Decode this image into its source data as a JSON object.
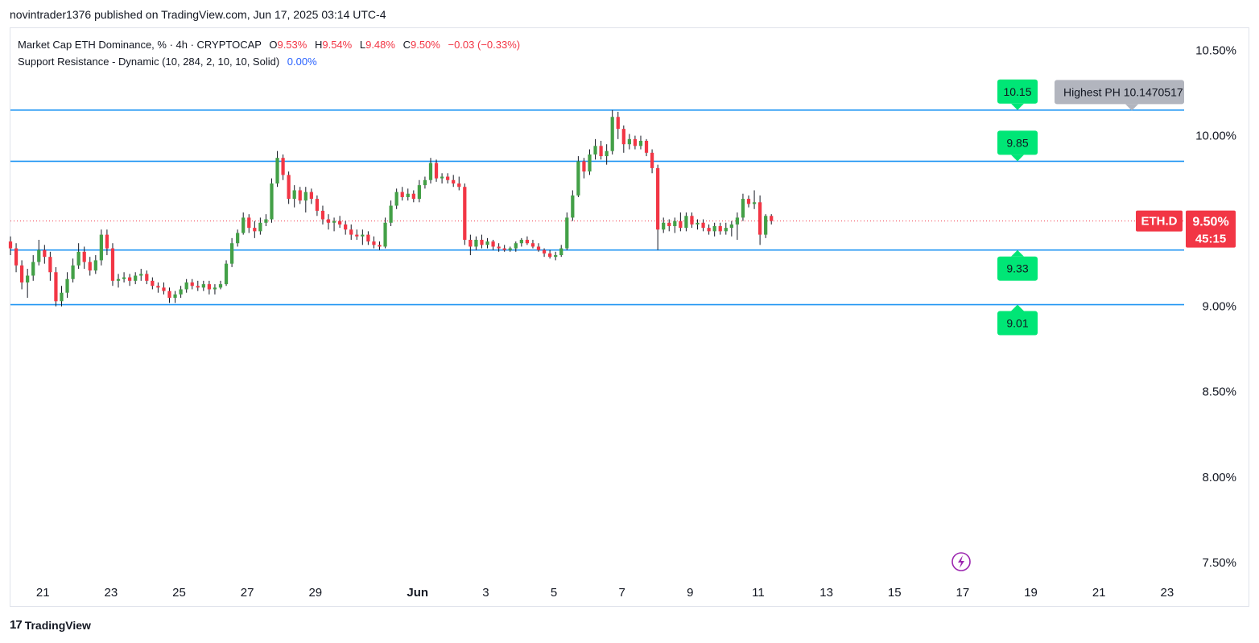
{
  "header": {
    "caption": "novintrader1376 published on TradingView.com, Jun 17, 2025 03:14 UTC-4"
  },
  "legend": {
    "symbol_line": "Market Cap ETH Dominance, % · 4h · CRYPTOCAP",
    "o_key": "O",
    "o_val": "9.53%",
    "h_key": "H",
    "h_val": "9.54%",
    "l_key": "L",
    "l_val": "9.48%",
    "c_key": "C",
    "c_val": "9.50%",
    "change": "−0.03 (−0.33%)",
    "indicator_line": "Support Resistance - Dynamic (10, 284, 2, 10, 10, Solid)",
    "indicator_val": "0.00%"
  },
  "footer": {
    "brand_mark": "17",
    "brand": "TradingView"
  },
  "colors": {
    "up": "#43a047",
    "down": "#f23645",
    "level": "#2196f3",
    "label_green": "#00e676",
    "label_gray": "#b2b5be",
    "price_badge": "#f23645",
    "wick": "#131722"
  },
  "chart_data": {
    "type": "candlestick",
    "y_unit": "%",
    "ylim": [
      7.4,
      10.63
    ],
    "y_ticks": [
      {
        "value": 10.5,
        "label": "10.50%"
      },
      {
        "value": 10.0,
        "label": "10.00%"
      },
      {
        "value": 9.0,
        "label": "9.00%"
      },
      {
        "value": 8.5,
        "label": "8.50%"
      },
      {
        "value": 8.0,
        "label": "8.00%"
      },
      {
        "value": 7.5,
        "label": "7.50%"
      }
    ],
    "x_ticks": [
      {
        "day": 21,
        "label": "21"
      },
      {
        "day": 23,
        "label": "23"
      },
      {
        "day": 25,
        "label": "25"
      },
      {
        "day": 27,
        "label": "27"
      },
      {
        "day": 29,
        "label": "29"
      },
      {
        "day": 32,
        "label": "Jun"
      },
      {
        "day": 34,
        "label": "3"
      },
      {
        "day": 36,
        "label": "5"
      },
      {
        "day": 38,
        "label": "7"
      },
      {
        "day": 40,
        "label": "9"
      },
      {
        "day": 42,
        "label": "11"
      },
      {
        "day": 44,
        "label": "13"
      },
      {
        "day": 46,
        "label": "15"
      },
      {
        "day": 48,
        "label": "17"
      },
      {
        "day": 50,
        "label": "19"
      },
      {
        "day": 52,
        "label": "21"
      },
      {
        "day": 54,
        "label": "23"
      }
    ],
    "x_range_days": [
      20.05,
      54.5
    ],
    "candle_start_day": 20.05,
    "candle_interval_days": 0.16667,
    "levels": [
      {
        "value": 10.15,
        "label": "10.15",
        "side": "resistance"
      },
      {
        "value": 9.85,
        "label": "9.85",
        "side": "resistance"
      },
      {
        "value": 9.33,
        "label": "9.33",
        "side": "support"
      },
      {
        "value": 9.01,
        "label": "9.01",
        "side": "support"
      }
    ],
    "highest_ph": {
      "label": "Highest PH 10.1470517",
      "value": 10.147
    },
    "last_price": {
      "symbol": "ETH.D",
      "value": "9.50%",
      "countdown": "45:15",
      "y": 9.5
    },
    "candles": [
      [
        9.38,
        9.41,
        9.3,
        9.34
      ],
      [
        9.34,
        9.37,
        9.2,
        9.24
      ],
      [
        9.24,
        9.27,
        9.1,
        9.14
      ],
      [
        9.14,
        9.22,
        9.05,
        9.18
      ],
      [
        9.18,
        9.3,
        9.15,
        9.26
      ],
      [
        9.26,
        9.39,
        9.24,
        9.33
      ],
      [
        9.33,
        9.36,
        9.25,
        9.29
      ],
      [
        9.29,
        9.32,
        9.15,
        9.2
      ],
      [
        9.2,
        9.23,
        9.0,
        9.03
      ],
      [
        9.03,
        9.12,
        9.0,
        9.08
      ],
      [
        9.08,
        9.2,
        9.05,
        9.16
      ],
      [
        9.16,
        9.28,
        9.14,
        9.24
      ],
      [
        9.24,
        9.37,
        9.22,
        9.32
      ],
      [
        9.32,
        9.35,
        9.22,
        9.26
      ],
      [
        9.26,
        9.29,
        9.18,
        9.21
      ],
      [
        9.21,
        9.3,
        9.19,
        9.27
      ],
      [
        9.27,
        9.45,
        9.24,
        9.42
      ],
      [
        9.42,
        9.45,
        9.3,
        9.34
      ],
      [
        9.34,
        9.37,
        9.12,
        9.15
      ],
      [
        9.15,
        9.19,
        9.11,
        9.16
      ],
      [
        9.16,
        9.2,
        9.14,
        9.17
      ],
      [
        9.17,
        9.19,
        9.12,
        9.15
      ],
      [
        9.15,
        9.2,
        9.13,
        9.18
      ],
      [
        9.18,
        9.22,
        9.15,
        9.19
      ],
      [
        9.19,
        9.21,
        9.13,
        9.15
      ],
      [
        9.15,
        9.17,
        9.1,
        9.12
      ],
      [
        9.12,
        9.14,
        9.08,
        9.11
      ],
      [
        9.11,
        9.14,
        9.07,
        9.09
      ],
      [
        9.09,
        9.11,
        9.02,
        9.05
      ],
      [
        9.05,
        9.09,
        9.02,
        9.07
      ],
      [
        9.07,
        9.12,
        9.05,
        9.1
      ],
      [
        9.1,
        9.16,
        9.08,
        9.14
      ],
      [
        9.14,
        9.16,
        9.1,
        9.12
      ],
      [
        9.12,
        9.15,
        9.09,
        9.11
      ],
      [
        9.11,
        9.15,
        9.09,
        9.13
      ],
      [
        9.13,
        9.15,
        9.07,
        9.1
      ],
      [
        9.1,
        9.13,
        9.07,
        9.11
      ],
      [
        9.11,
        9.15,
        9.1,
        9.13
      ],
      [
        9.13,
        9.27,
        9.12,
        9.25
      ],
      [
        9.25,
        9.4,
        9.23,
        9.37
      ],
      [
        9.37,
        9.45,
        9.35,
        9.43
      ],
      [
        9.43,
        9.55,
        9.42,
        9.52
      ],
      [
        9.52,
        9.54,
        9.43,
        9.46
      ],
      [
        9.46,
        9.5,
        9.4,
        9.44
      ],
      [
        9.44,
        9.52,
        9.42,
        9.49
      ],
      [
        9.49,
        9.54,
        9.47,
        9.51
      ],
      [
        9.51,
        9.75,
        9.49,
        9.72
      ],
      [
        9.72,
        9.91,
        9.7,
        9.87
      ],
      [
        9.87,
        9.89,
        9.74,
        9.77
      ],
      [
        9.77,
        9.79,
        9.6,
        9.63
      ],
      [
        9.63,
        9.71,
        9.58,
        9.68
      ],
      [
        9.68,
        9.7,
        9.6,
        9.62
      ],
      [
        9.62,
        9.7,
        9.55,
        9.67
      ],
      [
        9.67,
        9.69,
        9.6,
        9.63
      ],
      [
        9.63,
        9.65,
        9.53,
        9.56
      ],
      [
        9.56,
        9.59,
        9.48,
        9.51
      ],
      [
        9.51,
        9.54,
        9.45,
        9.49
      ],
      [
        9.49,
        9.52,
        9.44,
        9.5
      ],
      [
        9.5,
        9.53,
        9.46,
        9.48
      ],
      [
        9.48,
        9.5,
        9.42,
        9.45
      ],
      [
        9.45,
        9.48,
        9.39,
        9.42
      ],
      [
        9.42,
        9.45,
        9.39,
        9.41
      ],
      [
        9.41,
        9.45,
        9.36,
        9.42
      ],
      [
        9.42,
        9.44,
        9.36,
        9.38
      ],
      [
        9.38,
        9.41,
        9.34,
        9.36
      ],
      [
        9.36,
        9.38,
        9.33,
        9.35
      ],
      [
        9.35,
        9.52,
        9.34,
        9.49
      ],
      [
        9.49,
        9.62,
        9.47,
        9.59
      ],
      [
        9.59,
        9.69,
        9.57,
        9.67
      ],
      [
        9.67,
        9.7,
        9.62,
        9.64
      ],
      [
        9.64,
        9.69,
        9.62,
        9.66
      ],
      [
        9.66,
        9.68,
        9.61,
        9.63
      ],
      [
        9.63,
        9.74,
        9.61,
        9.71
      ],
      [
        9.71,
        9.76,
        9.69,
        9.74
      ],
      [
        9.74,
        9.87,
        9.72,
        9.84
      ],
      [
        9.84,
        9.86,
        9.73,
        9.75
      ],
      [
        9.75,
        9.78,
        9.72,
        9.76
      ],
      [
        9.76,
        9.78,
        9.72,
        9.74
      ],
      [
        9.74,
        9.77,
        9.7,
        9.72
      ],
      [
        9.72,
        9.76,
        9.68,
        9.7
      ],
      [
        9.7,
        9.72,
        9.36,
        9.39
      ],
      [
        9.39,
        9.42,
        9.3,
        9.35
      ],
      [
        9.35,
        9.41,
        9.33,
        9.39
      ],
      [
        9.39,
        9.42,
        9.34,
        9.36
      ],
      [
        9.36,
        9.4,
        9.34,
        9.38
      ],
      [
        9.38,
        9.39,
        9.33,
        9.35
      ],
      [
        9.35,
        9.37,
        9.32,
        9.34
      ],
      [
        9.34,
        9.36,
        9.32,
        9.33
      ],
      [
        9.33,
        9.35,
        9.32,
        9.34
      ],
      [
        9.34,
        9.38,
        9.32,
        9.37
      ],
      [
        9.37,
        9.4,
        9.35,
        9.39
      ],
      [
        9.39,
        9.41,
        9.36,
        9.37
      ],
      [
        9.37,
        9.39,
        9.34,
        9.35
      ],
      [
        9.35,
        9.37,
        9.32,
        9.33
      ],
      [
        9.33,
        9.34,
        9.29,
        9.31
      ],
      [
        9.31,
        9.33,
        9.28,
        9.29
      ],
      [
        9.29,
        9.32,
        9.27,
        9.3
      ],
      [
        9.3,
        9.36,
        9.29,
        9.34
      ],
      [
        9.34,
        9.55,
        9.33,
        9.52
      ],
      [
        9.52,
        9.68,
        9.5,
        9.65
      ],
      [
        9.65,
        9.88,
        9.64,
        9.85
      ],
      [
        9.85,
        9.87,
        9.75,
        9.79
      ],
      [
        9.79,
        9.92,
        9.77,
        9.89
      ],
      [
        9.89,
        9.98,
        9.86,
        9.94
      ],
      [
        9.94,
        9.97,
        9.86,
        9.88
      ],
      [
        9.88,
        9.95,
        9.83,
        9.91
      ],
      [
        9.91,
        10.15,
        9.89,
        10.11
      ],
      [
        10.11,
        10.14,
        9.98,
        10.04
      ],
      [
        10.04,
        10.06,
        9.9,
        9.95
      ],
      [
        9.95,
        10.01,
        9.92,
        9.98
      ],
      [
        9.98,
        10.0,
        9.92,
        9.94
      ],
      [
        9.94,
        10.0,
        9.92,
        9.97
      ],
      [
        9.97,
        9.98,
        9.88,
        9.9
      ],
      [
        9.9,
        9.92,
        9.78,
        9.81
      ],
      [
        9.81,
        9.83,
        9.33,
        9.45
      ],
      [
        9.45,
        9.52,
        9.43,
        9.49
      ],
      [
        9.49,
        9.51,
        9.44,
        9.47
      ],
      [
        9.47,
        9.52,
        9.43,
        9.5
      ],
      [
        9.5,
        9.55,
        9.44,
        9.46
      ],
      [
        9.46,
        9.55,
        9.44,
        9.53
      ],
      [
        9.53,
        9.55,
        9.46,
        9.48
      ],
      [
        9.48,
        9.51,
        9.45,
        9.49
      ],
      [
        9.49,
        9.51,
        9.44,
        9.46
      ],
      [
        9.46,
        9.48,
        9.42,
        9.44
      ],
      [
        9.44,
        9.49,
        9.41,
        9.47
      ],
      [
        9.47,
        9.49,
        9.42,
        9.44
      ],
      [
        9.44,
        9.49,
        9.42,
        9.46
      ],
      [
        9.46,
        9.5,
        9.41,
        9.48
      ],
      [
        9.48,
        9.55,
        9.39,
        9.52
      ],
      [
        9.52,
        9.66,
        9.5,
        9.63
      ],
      [
        9.63,
        9.65,
        9.58,
        9.6
      ],
      [
        9.6,
        9.68,
        9.57,
        9.61
      ],
      [
        9.61,
        9.65,
        9.36,
        9.42
      ],
      [
        9.42,
        9.54,
        9.4,
        9.53
      ],
      [
        9.53,
        9.54,
        9.48,
        9.5
      ]
    ]
  }
}
